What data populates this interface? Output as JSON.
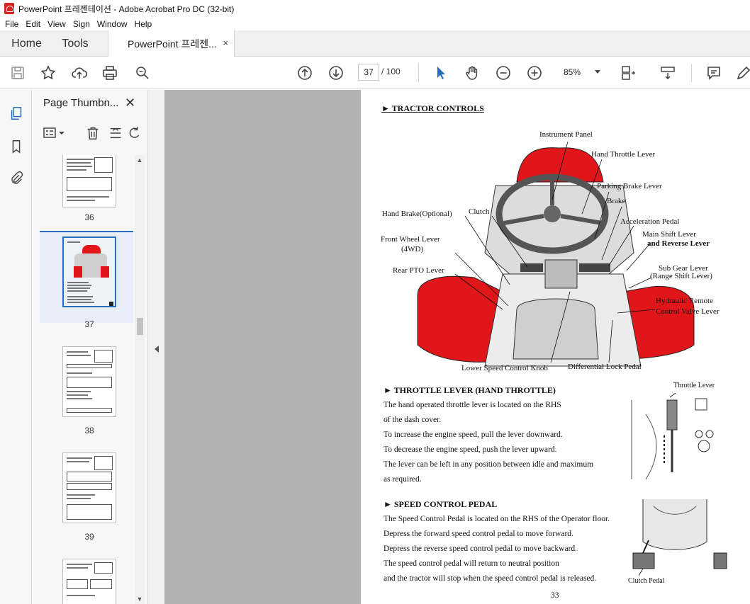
{
  "window": {
    "title": "PowerPoint 프레젠테이션 - Adobe Acrobat Pro DC (32-bit)"
  },
  "menu": [
    "File",
    "Edit",
    "View",
    "Sign",
    "Window",
    "Help"
  ],
  "tabs": {
    "home": "Home",
    "tools": "Tools",
    "document": "PowerPoint 프레젠...",
    "close": "×"
  },
  "toolbar": {
    "current_page": "37",
    "total_pages": "/ 100",
    "zoom": "85%",
    "icons": [
      "save-icon",
      "star-icon",
      "upload-icon",
      "print-icon",
      "zoom-search-icon",
      "page-up-icon",
      "page-down-icon",
      "select-arrow-icon",
      "hand-icon",
      "zoom-out-icon",
      "zoom-in-icon",
      "fit-page-icon",
      "scroll-mode-icon",
      "comment-icon",
      "pen-icon"
    ]
  },
  "sidebar": {
    "header": "Page Thumbn...",
    "close": "✕",
    "thumbnails": [
      {
        "label": "36"
      },
      {
        "label": "37",
        "selected": true
      },
      {
        "label": "38"
      },
      {
        "label": "39"
      }
    ]
  },
  "document": {
    "heading_controls": "► TRACTOR CONTROLS",
    "diagram_labels": {
      "instrument_panel": "Instrument Panel",
      "hand_throttle": "Hand Throttle Lever",
      "parking_brake": "Parking Brake Lever",
      "brake": "Brake",
      "acceleration_pedal": "Acceleration Pedal",
      "main_shift_1": "Main Shift Lever",
      "main_shift_2": "and Reverse Lever",
      "hand_brake": "Hand Brake(Optional)",
      "clutch": "Clutch",
      "front_wheel_1": "Front Wheel Lever",
      "front_wheel_2": "(4WD)",
      "rear_pto": "Rear PTO Lever",
      "sub_gear_1": "Sub Gear Lever",
      "sub_gear_2": "(Range Shift Lever)",
      "hydraulic_1": "Hydraulic Remote",
      "hydraulic_2": "Control Valve Lever",
      "lower_speed": "Lower Speed Control Knob",
      "diff_lock": "Differential Lock Pedal"
    },
    "throttle": {
      "heading": "► THROTTLE LEVER (HAND THROTTLE)",
      "image_label": "Throttle Lever",
      "lines": [
        "The hand operated throttle lever is located on the RHS",
        "of the dash cover.",
        "To increase the engine speed, pull the lever downward.",
        "To decrease the engine speed, push the lever upward.",
        "The lever can be left in any position between idle and maximum",
        "as required."
      ]
    },
    "speed": {
      "heading": "► SPEED CONTROL PEDAL",
      "image_label": "Clutch Pedal",
      "lines": [
        "The Speed Control Pedal is located on the RHS of the Operator floor.",
        "Depress the forward speed control pedal to move forward.",
        "Depress the reverse speed control pedal to move backward.",
        "The speed control pedal will return to neutral position",
        "and the tractor will stop when the speed control pedal is released."
      ]
    },
    "page_number": "33"
  },
  "colors": {
    "accent_blue": "#2a6ebb",
    "acrobat_red": "#d8261e",
    "diagram_red": "#e0161b"
  }
}
